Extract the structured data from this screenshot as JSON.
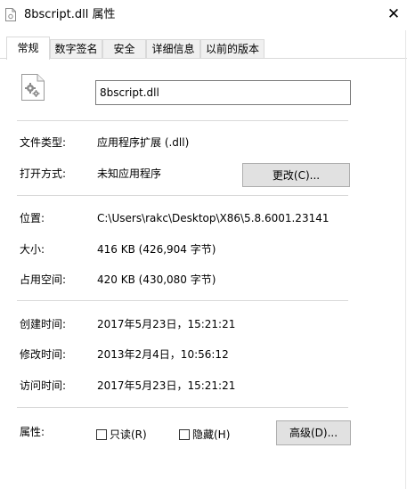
{
  "window": {
    "title": "8bscript.dll 属性",
    "close_label": "✕"
  },
  "tabs": [
    {
      "label": "常规",
      "active": true
    },
    {
      "label": "数字签名",
      "active": false
    },
    {
      "label": "安全",
      "active": false
    },
    {
      "label": "详细信息",
      "active": false
    },
    {
      "label": "以前的版本",
      "active": false
    }
  ],
  "general": {
    "file_name": "8bscript.dll",
    "file_type_label": "文件类型:",
    "file_type_value": "应用程序扩展 (.dll)",
    "opens_with_label": "打开方式:",
    "opens_with_value": "未知应用程序",
    "change_button": "更改(C)...",
    "location_label": "位置:",
    "location_value": "C:\\Users\\rakc\\Desktop\\X86\\5.8.6001.23141",
    "size_label": "大小:",
    "size_value": "416 KB (426,904 字节)",
    "size_on_disk_label": "占用空间:",
    "size_on_disk_value": "420 KB (430,080 字节)",
    "created_label": "创建时间:",
    "created_value": "2017年5月23日，15:21:21",
    "modified_label": "修改时间:",
    "modified_value": "2013年2月4日，10:56:12",
    "accessed_label": "访问时间:",
    "accessed_value": "2017年5月23日，15:21:21",
    "attributes_label": "属性:",
    "readonly_label": "只读(R)",
    "readonly_checked": false,
    "hidden_label": "隐藏(H)",
    "hidden_checked": false,
    "advanced_button": "高级(D)..."
  },
  "icons": {
    "title": "dll-file-icon",
    "file": "dll-file-gear-icon"
  },
  "colors": {
    "tab_border": "#d9d9d9",
    "separator": "#d9d9d9",
    "button_face": "#e1e1e1",
    "button_border": "#adadad"
  }
}
